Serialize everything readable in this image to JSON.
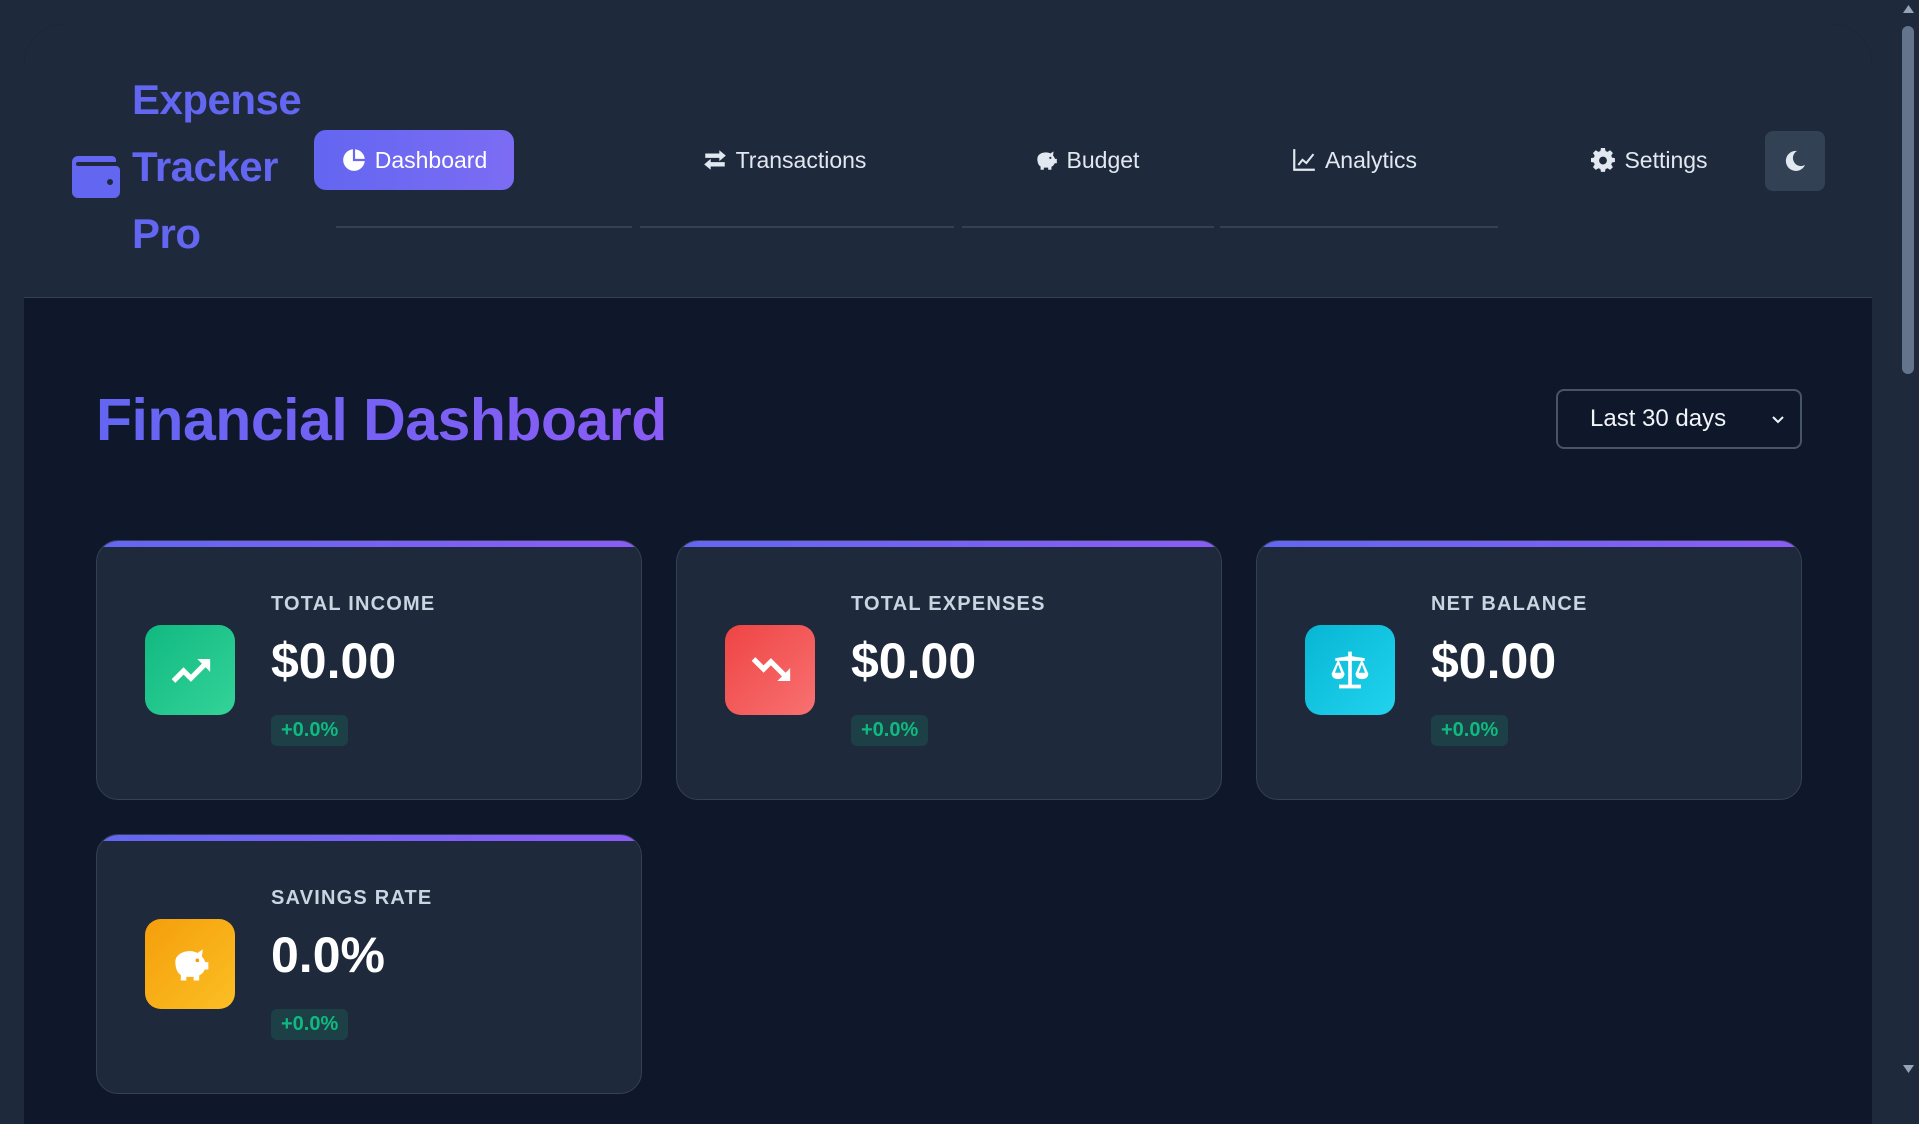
{
  "app": {
    "title_lines": [
      "Expense",
      "Tracker",
      "Pro"
    ]
  },
  "nav": {
    "items": [
      {
        "label": "Dashboard",
        "icon": "pie-chart-icon",
        "active": true
      },
      {
        "label": "Transactions",
        "icon": "exchange-arrows-icon",
        "active": false
      },
      {
        "label": "Budget",
        "icon": "piggy-bank-icon",
        "active": false
      },
      {
        "label": "Analytics",
        "icon": "line-chart-icon",
        "active": false
      },
      {
        "label": "Settings",
        "icon": "gear-icon",
        "active": false
      }
    ],
    "theme_toggle_icon": "moon-icon"
  },
  "main": {
    "title": "Financial Dashboard",
    "period_select": {
      "selected": "Last 30 days"
    }
  },
  "cards": [
    {
      "label": "TOTAL INCOME",
      "value": "$0.00",
      "change": "+0.0%",
      "icon": "trend-up-icon",
      "color": "#10b981"
    },
    {
      "label": "TOTAL EXPENSES",
      "value": "$0.00",
      "change": "+0.0%",
      "icon": "trend-down-icon",
      "color": "#ef4444"
    },
    {
      "label": "NET BALANCE",
      "value": "$0.00",
      "change": "+0.0%",
      "icon": "balance-scale-icon",
      "color": "#06b6d4"
    },
    {
      "label": "SAVINGS RATE",
      "value": "0.0%",
      "change": "+0.0%",
      "icon": "piggy-bank-icon",
      "color": "#f59e0b"
    }
  ],
  "colors": {
    "accent": "#6366f1",
    "accent_secondary": "#8b5cf6",
    "positive": "#10b981",
    "background": "#0f172a",
    "surface": "#1e293b"
  }
}
